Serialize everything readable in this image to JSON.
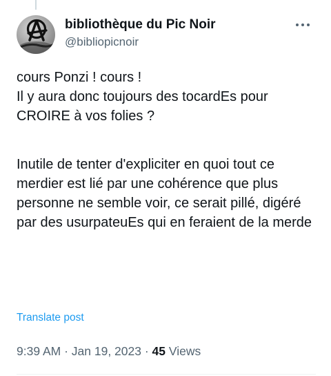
{
  "author": {
    "display_name": "bibliothèque du Pic Noir",
    "handle": "@bibliopicnoir",
    "avatar_icon": "anarchy-a-avatar"
  },
  "more_icon": "more-horizontal-icon",
  "tweet": {
    "paragraph1_line1": "cours Ponzi ! cours !",
    "paragraph1_line2": "Il y aura donc toujours des tocardEs pour CROIRE à vos folies ?",
    "paragraph2": "Inutile de tenter d'expliciter en quoi tout ce merdier est lié par une cohérence que plus personne ne semble voir, ce serait pillé, digéré par des usurpateuEs qui en feraient de la merde"
  },
  "translate_label": "Translate post",
  "meta": {
    "time": "9:39 AM",
    "separator1": " · ",
    "date": "Jan 19, 2023",
    "separator2": " · ",
    "views_count": "45",
    "views_label": " Views"
  },
  "colors": {
    "text": "#0f1419",
    "secondary": "#536471",
    "link": "#1d9bf0",
    "divider": "#eff3f4"
  }
}
